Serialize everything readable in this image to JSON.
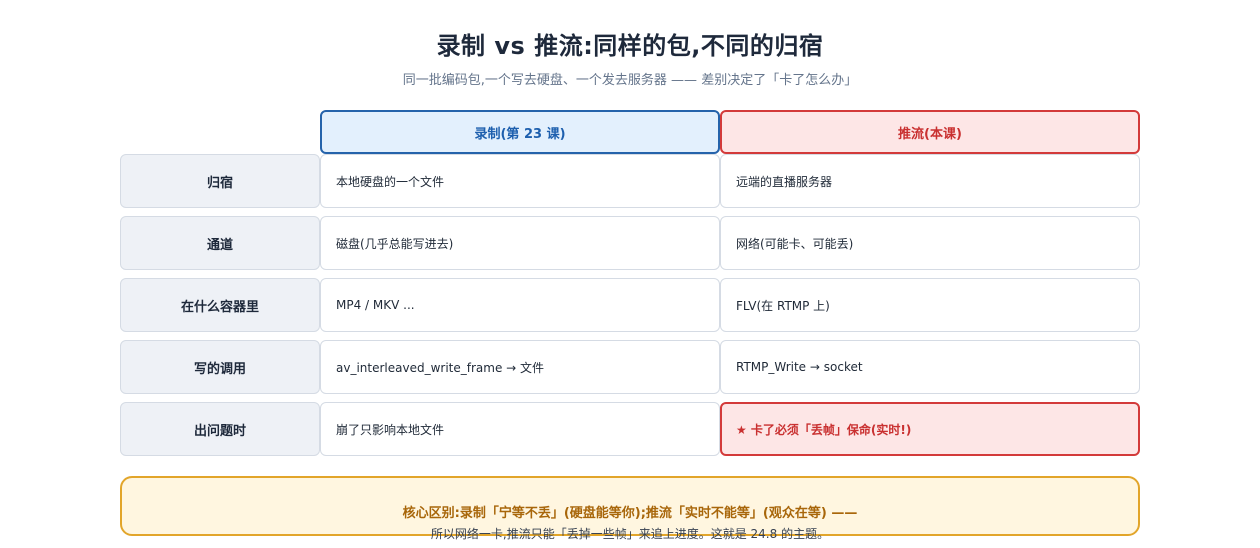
{
  "title": "录制 vs 推流:同样的包,不同的归宿",
  "subtitle": "同一批编码包,一个写去硬盘、一个发去服务器 —— 差别决定了「卡了怎么办」",
  "columns": {
    "record": "录制(第 23 课)",
    "push": "推流(本课)"
  },
  "rows": [
    {
      "label": "归宿",
      "record": "本地硬盘的一个文件",
      "push": "远端的直播服务器"
    },
    {
      "label": "通道",
      "record": "磁盘(几乎总能写进去)",
      "push": "网络(可能卡、可能丢)"
    },
    {
      "label": "在什么容器里",
      "record": "MP4 / MKV ...",
      "push": "FLV(在 RTMP 上)"
    },
    {
      "label": "写的调用",
      "record": "av_interleaved_write_frame → 文件",
      "push": "RTMP_Write → socket"
    },
    {
      "label": "出问题时",
      "record": "崩了只影响本地文件",
      "push": "★ 卡了必须「丢帧」保命(实时!)"
    }
  ],
  "callout": {
    "line1": "核心区别:录制「宁等不丢」(硬盘能等你);推流「实时不能等」(观众在等) ——",
    "line2": "所以网络一卡,推流只能「丢掉一些帧」来追上进度。这就是 24.8 的主题。"
  },
  "colors": {
    "record_accent": "#2563ab",
    "push_accent": "#d33a3a",
    "callout_accent": "#e2a52a"
  }
}
